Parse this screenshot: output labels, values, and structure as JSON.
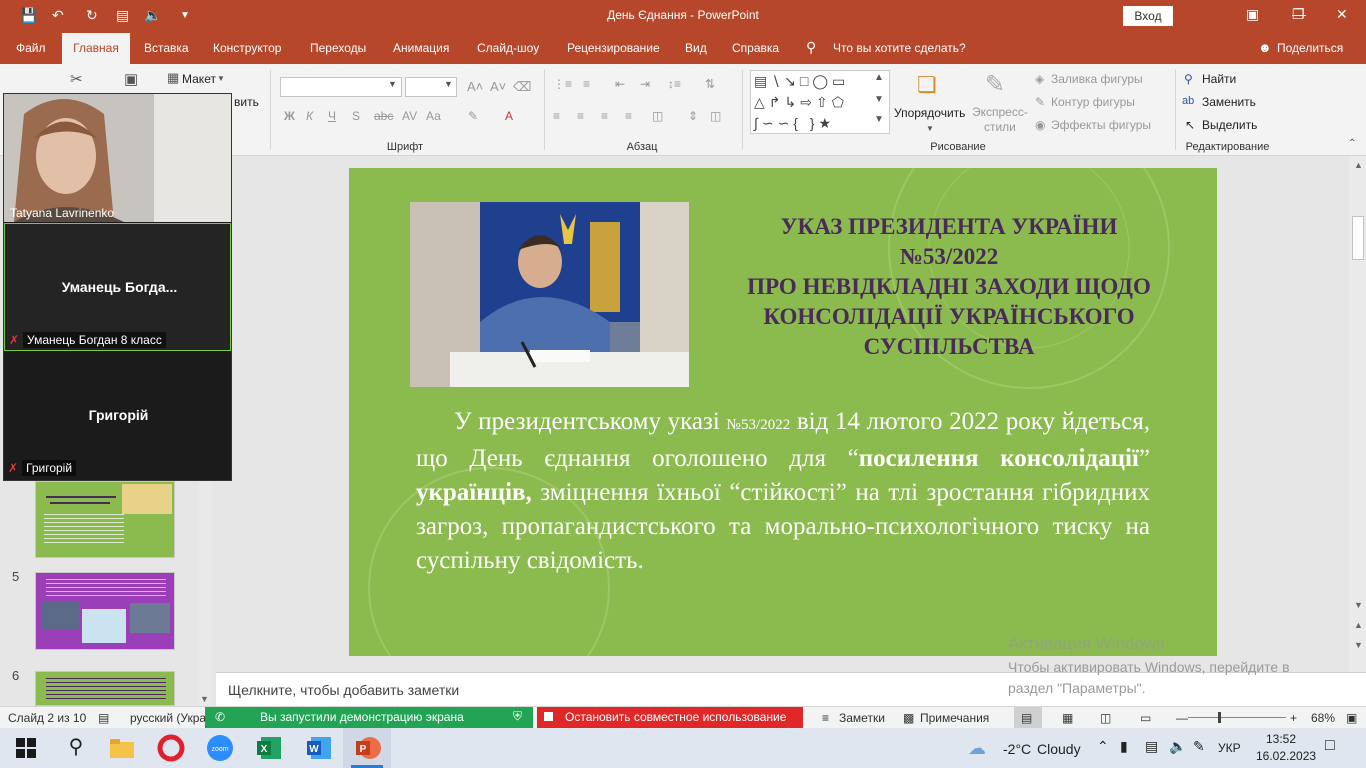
{
  "window": {
    "title": "День Єднання  -  PowerPoint",
    "signin": "Вход"
  },
  "tabs": [
    "Файл",
    "Главная",
    "Вставка",
    "Конструктор",
    "Переходы",
    "Анимация",
    "Слайд-шоу",
    "Рецензирование",
    "Вид",
    "Справка"
  ],
  "tell_me": "Что вы хотите сделать?",
  "share": "Поделиться",
  "ribbon": {
    "layout": "Макет",
    "groups": {
      "font": "Шрифт",
      "paragraph": "Абзац",
      "drawing": "Рисование",
      "editing": "Редактирование"
    },
    "bold": "Ж",
    "italic": "К",
    "underline": "Ч",
    "strike": "S",
    "fontcase": "Аа",
    "arrange": "Упорядочить",
    "quick_styles": "Экспресс-\nстили",
    "shape_fill": "Заливка фигуры",
    "shape_outline": "Контур фигуры",
    "shape_effects": "Эффекты фигуры",
    "find": "Найти",
    "replace": "Заменить",
    "select": "Выделить"
  },
  "zoom_meeting": {
    "participants": [
      {
        "name": "Tatyana Lavrinenko"
      },
      {
        "display": "Уманець  Богда...",
        "name": "Уманець Богдан 8 класс"
      },
      {
        "display": "Григорій",
        "name": "Григорій"
      }
    ]
  },
  "thumbnails": [
    {
      "num": "5"
    },
    {
      "num": "6"
    }
  ],
  "slide": {
    "title_lines": [
      "УКАЗ ПРЕЗИДЕНТА УКРАЇНИ",
      "№53/2022",
      "ПРО НЕВІДКЛАДНІ ЗАХОДИ ЩОДО",
      "КОНСОЛІДАЦІЇ УКРАЇНСЬКОГО",
      "СУСПІЛЬСТВА"
    ],
    "body_p1": "У президентському указі ",
    "body_num": "№53/2022",
    "body_p2": " від 14 лютого 2022 року йдеться, що День єднання оголошено для  “",
    "body_b1": "посилення консолідації",
    "body_p3": "” ",
    "body_b2": "українців,",
    "body_p4": " зміцнення їхньої “стійкості” на тлі зростання гібридних загроз, пропагандистського та морально-психологічного тиску на суспільну свідомість."
  },
  "notes_placeholder": "Щелкните, чтобы добавить заметки",
  "activation": {
    "title": "Активация Windows",
    "line1": "Чтобы активировать Windows, перейдите в",
    "line2": "раздел \"Параметры\"."
  },
  "status": {
    "slide": "Слайд 2 из 10",
    "lang": "русский (Укра",
    "sharing": "Вы запустили демонстрацию экрана",
    "stop": "Остановить совместное использование",
    "notes": "Заметки",
    "comments": "Примечания",
    "zoom": "68%"
  },
  "taskbar": {
    "weather_temp": "-2°C",
    "weather_desc": "Cloudy",
    "lang": "УКР",
    "time": "13:52",
    "date": "16.02.2023"
  },
  "colors": {
    "accent": "#b7472a",
    "slide_bg": "#8bbb4e",
    "title_color": "#4a2a5a"
  }
}
